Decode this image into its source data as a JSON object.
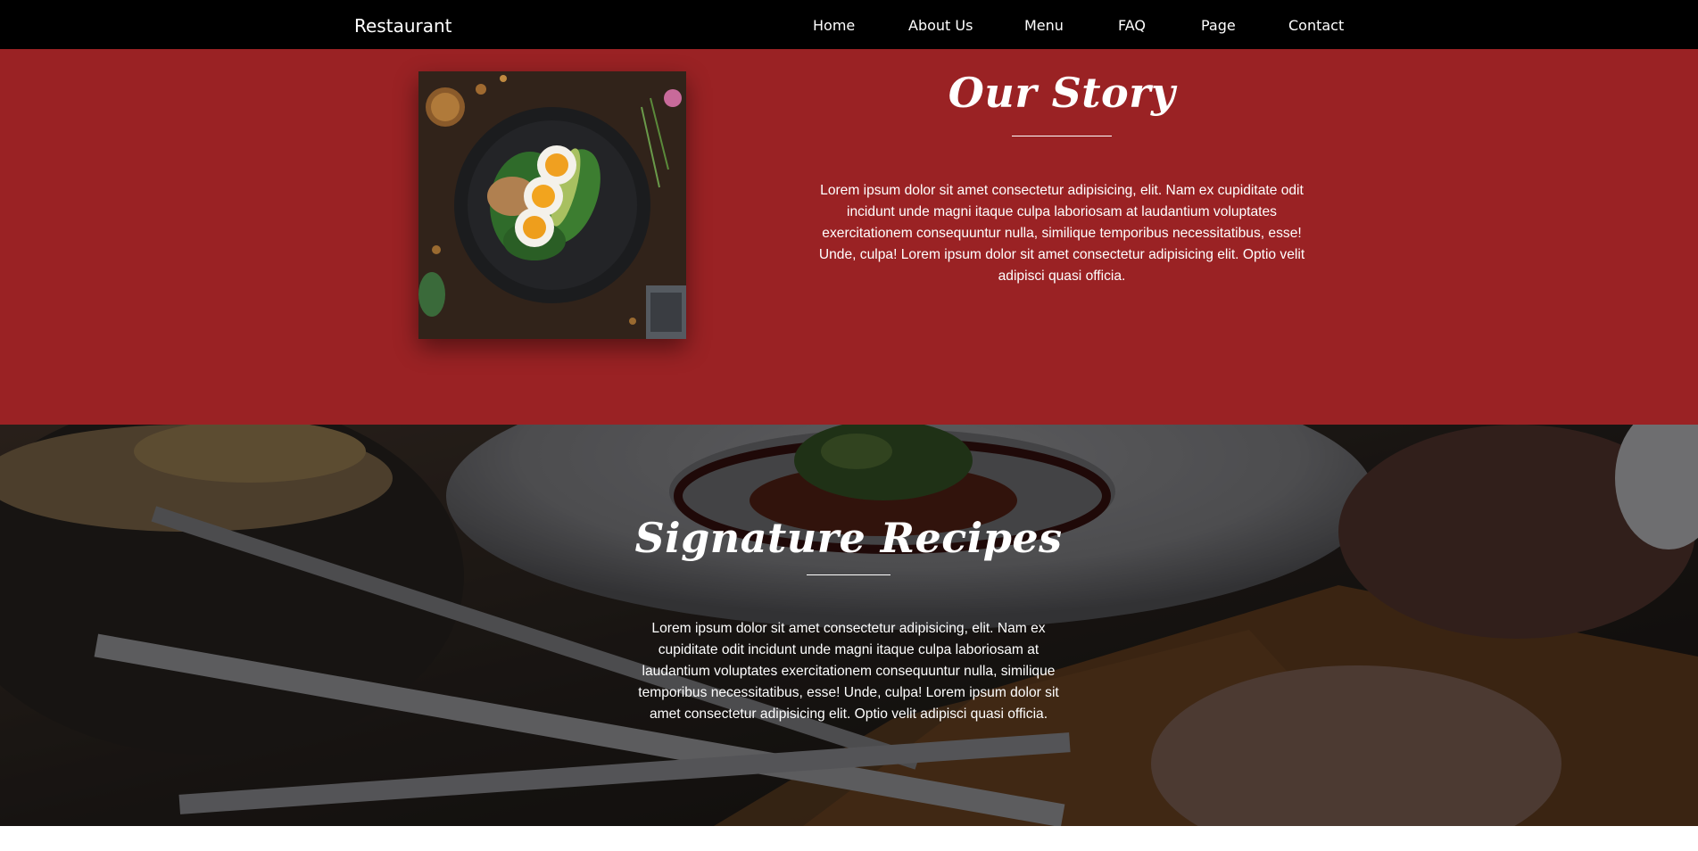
{
  "navbar": {
    "brand": "Restaurant",
    "links": [
      "Home",
      "About Us",
      "Menu",
      "FAQ",
      "Page",
      "Contact"
    ]
  },
  "story": {
    "title": "Our Story",
    "text": "Lorem ipsum dolor sit amet consectetur adipisicing, elit. Nam ex cupiditate odit incidunt unde magni itaque culpa laboriosam at laudantium voluptates exercitationem consequuntur nulla, similique temporibus necessitatibus, esse! Unde, culpa! Lorem ipsum dolor sit amet consectetur adipisicing elit. Optio velit adipisci quasi officia."
  },
  "recipes": {
    "title": "Signature Recipes",
    "text": "Lorem ipsum dolor sit amet consectetur adipisicing, elit. Nam ex cupiditate odit incidunt unde magni itaque culpa laboriosam at laudantium voluptates exercitationem consequuntur nulla, similique temporibus necessitatibus, esse! Unde, culpa! Lorem ipsum dolor sit amet consectetur adipisicing elit. Optio velit adipisci quasi officia."
  },
  "colors": {
    "navbar_bg": "#000000",
    "story_bg": "#9a2224",
    "text": "#ffffff"
  }
}
